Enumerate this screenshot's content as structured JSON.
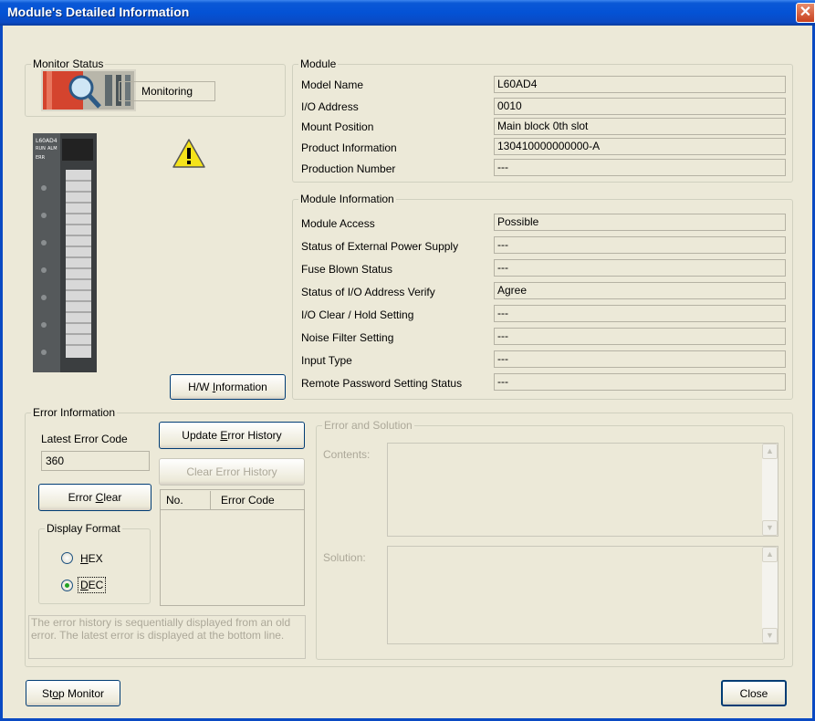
{
  "window": {
    "title": "Module's Detailed Information",
    "close_glyph": "✕"
  },
  "monitor_status": {
    "legend": "Monitor Status",
    "state": "Monitoring"
  },
  "module": {
    "legend": "Module",
    "rows": [
      {
        "label": "Model Name",
        "value": "L60AD4"
      },
      {
        "label": "I/O Address",
        "value": "0010"
      },
      {
        "label": "Mount Position",
        "value": "Main block 0th slot"
      },
      {
        "label": "Product Information",
        "value": "130410000000000-A"
      },
      {
        "label": "Production Number",
        "value": "---"
      }
    ]
  },
  "module_information": {
    "legend": "Module Information",
    "rows": [
      {
        "label": "Module Access",
        "value": "Possible"
      },
      {
        "label": "Status of External Power Supply",
        "value": "---"
      },
      {
        "label": "Fuse Blown Status",
        "value": "---"
      },
      {
        "label": "Status of I/O Address Verify",
        "value": "Agree"
      },
      {
        "label": "I/O Clear / Hold Setting",
        "value": "---"
      },
      {
        "label": "Noise Filter Setting",
        "value": "---"
      },
      {
        "label": "Input Type",
        "value": "---"
      },
      {
        "label": "Remote Password Setting Status",
        "value": "---"
      }
    ]
  },
  "hw_info_button": {
    "pre": "H/W ",
    "u": "I",
    "post": "nformation"
  },
  "module_image": {
    "model": "L60AD4",
    "run": "RUN",
    "alm": "ALM",
    "err": "ERR"
  },
  "error_information": {
    "legend": "Error Information",
    "latest_error_label": "Latest Error Code",
    "latest_error_value": "360",
    "update_history": {
      "pre": "Update ",
      "u": "E",
      "post": "rror History"
    },
    "clear_history": "Clear Error History",
    "error_clear": {
      "pre": "Error ",
      "u": "C",
      "post": "lear"
    },
    "history_columns": [
      "No.",
      "Error Code"
    ],
    "display_format": {
      "legend": "Display Format",
      "hex": {
        "pre": "",
        "u": "H",
        "post": "EX"
      },
      "dec": {
        "pre": "",
        "u": "D",
        "post": "EC"
      },
      "selected": "DEC"
    },
    "hint": "The error history is sequentially displayed from an old error. The latest error is displayed at the bottom line."
  },
  "error_solution": {
    "legend": "Error and Solution",
    "contents_label": "Contents:",
    "solution_label": "Solution:"
  },
  "footer": {
    "stop_monitor": {
      "pre": "St",
      "u": "o",
      "post": "p Monitor"
    },
    "close": "Close"
  },
  "colors": {
    "title_bar": "#0452d5",
    "window_bg": "#ece9d8",
    "warning": "#f5e31a"
  },
  "icons": [
    "monitor-status-icon",
    "warning-icon",
    "plc-module-icon"
  ]
}
